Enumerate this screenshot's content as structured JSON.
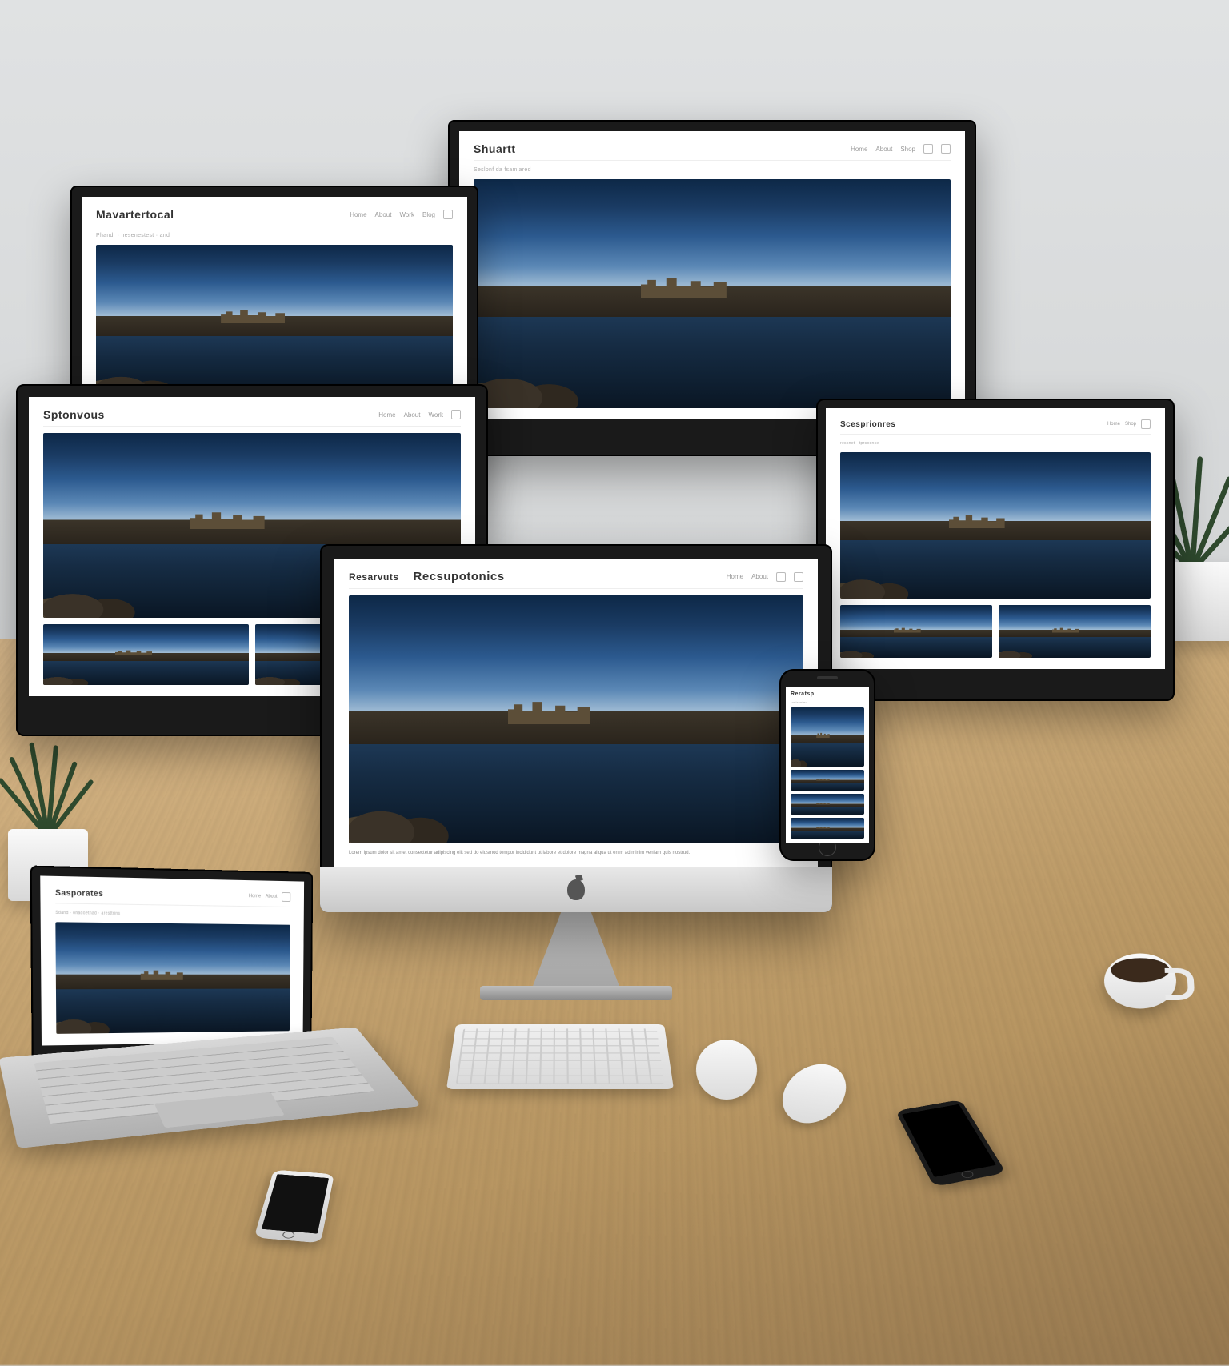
{
  "scene": "responsive-website-device-mockup",
  "devices": {
    "monitor_back_left": {
      "brand": "Mavartertocal",
      "subline": "Phandr · nesenestest · and",
      "nav": [
        "Home",
        "About",
        "Work",
        "Blog"
      ],
      "thumbs_count": 3
    },
    "monitor_back_right": {
      "brand": "Shuartt",
      "subline": "Seslonf da fsamiared",
      "nav": [
        "Home",
        "About",
        "Shop"
      ],
      "thumbs_count": 0
    },
    "monitor_mid_left_upper": {
      "brand": "Sptonvous",
      "subline": "",
      "nav": [
        "Home",
        "About",
        "Work"
      ],
      "thumbs_count": 2
    },
    "monitor_mid_right": {
      "brand": "Scesprionres",
      "subline": "ressnet · tprsodnse",
      "nav": [
        "Home",
        "Shop"
      ],
      "thumbs_count": 2
    },
    "imac_front": {
      "brand_left": "Resarvuts",
      "brand_center": "Recsupotonics",
      "subline": "",
      "nav": [
        "Home",
        "About"
      ],
      "thumbs_count": 0,
      "body_text": "Lorem ipsum dolor sit amet consectetur adipiscing elit sed do eiusmod tempor incididunt ut labore et dolore magna aliqua ut enim ad minim veniam quis nostrud."
    },
    "phone": {
      "brand": "Reratsp",
      "subline": "rostronted",
      "thumbs_count": 3
    },
    "laptop": {
      "brand": "Sasporates",
      "subline": "Sdand · onadoetnad · aresttrins",
      "nav": [
        "Home",
        "About"
      ],
      "thumbs_count": 0
    }
  },
  "colors": {
    "sky_top": "#0d2847",
    "sky_horizon": "#a8c2d8",
    "water": "#1e3a58",
    "mountain": "#3d3526",
    "desk": "#c9a876",
    "device_bezel": "#1a1a1a"
  }
}
